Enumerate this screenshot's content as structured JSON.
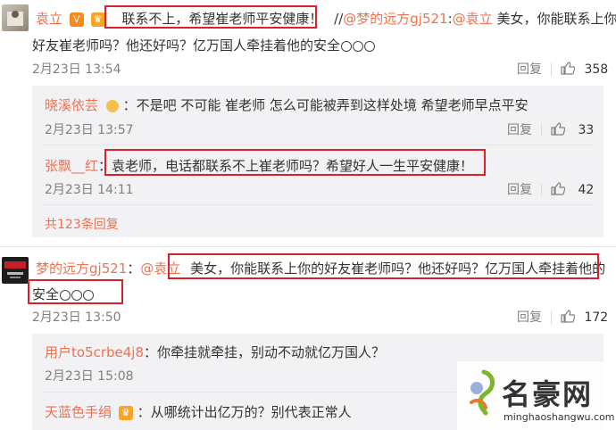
{
  "comment1": {
    "user": "袁立",
    "quote": "联系不上，希望崔老师平安健康！",
    "repost_sep": "//",
    "mention": "@梦的远方gj521",
    "colon": ":",
    "mention2": "@袁立",
    "text_tail": " 美女，你能联系上你的",
    "line2": "好友崔老师吗？他还好吗？亿万国人牵挂着他的安全",
    "time": "2月23日 13:54",
    "reply": "回复",
    "likes": "358"
  },
  "reply1": {
    "user": "晓溪依芸",
    "text": "：不是吧 不可能 崔老师 怎么可能被弄到这样处境 希望老师早点平安",
    "time": "2月23日 13:57",
    "reply": "回复",
    "likes": "33"
  },
  "reply2": {
    "user": "张飘__红",
    "colon": "：",
    "text": "袁老师，电话都联系不上崔老师吗？希望好人一生平安健康！",
    "time": "2月23日 14:11",
    "reply": "回复",
    "likes": "42"
  },
  "more": "共123条回复",
  "comment2": {
    "user": "梦的远方gj521",
    "colon": "：",
    "mention": "@袁立",
    "text": "美女，你能联系上你的好友崔老师吗？他还好吗？亿万国人牵挂着他的",
    "line2": "安全",
    "time": "2月23日 13:50",
    "reply": "回复",
    "likes": "172"
  },
  "reply3": {
    "user": "用户to5crbe4j8",
    "text": "：你牵挂就牵挂，别动不动就亿万国人？",
    "time": "2月23日 15:08"
  },
  "reply4": {
    "user": "天蓝色手绢",
    "text": "：从哪统计出亿万的？别代表正常人"
  },
  "watermark": {
    "brand": "名豪网",
    "url": "minghaoshangwu.com"
  },
  "colors": {
    "name": "#eb7350",
    "box": "#d9202c",
    "subbg": "#f2f2f5"
  }
}
